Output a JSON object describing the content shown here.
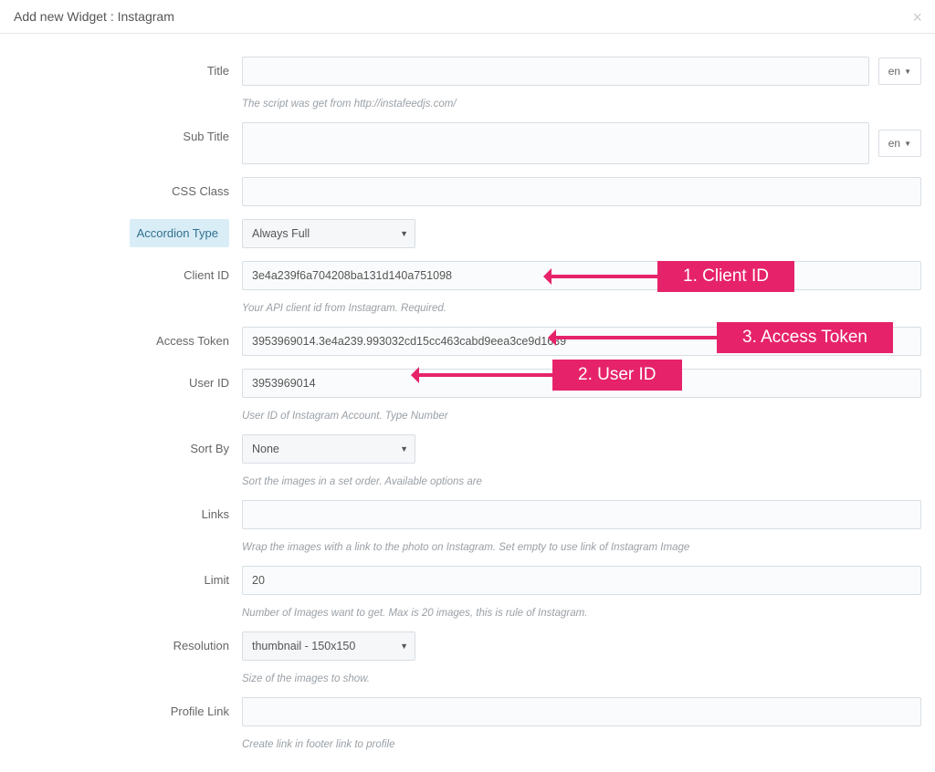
{
  "header": {
    "title": "Add new Widget : Instagram"
  },
  "lang": {
    "label": "en"
  },
  "fields": {
    "title": {
      "label": "Title",
      "value": "",
      "help": "The script was get from http://instafeedjs.com/"
    },
    "subtitle": {
      "label": "Sub Title",
      "value": ""
    },
    "cssclass": {
      "label": "CSS Class",
      "value": ""
    },
    "accordion": {
      "label": "Accordion Type",
      "value": "Always Full"
    },
    "clientid": {
      "label": "Client ID",
      "value": "3e4a239f6a704208ba131d140a751098",
      "help": "Your API client id from Instagram. Required."
    },
    "accesstoken": {
      "label": "Access Token",
      "value": "3953969014.3e4a239.993032cd15cc463cabd9eea3ce9d1639"
    },
    "userid": {
      "label": "User ID",
      "value": "3953969014",
      "help": "User ID of Instagram Account. Type Number"
    },
    "sortby": {
      "label": "Sort By",
      "value": "None",
      "help": "Sort the images in a set order. Available options are"
    },
    "links": {
      "label": "Links",
      "value": "",
      "help": "Wrap the images with a link to the photo on Instagram. Set empty to use link of Instagram Image"
    },
    "limit": {
      "label": "Limit",
      "value": "20",
      "help": "Number of Images want to get. Max is 20 images, this is rule of Instagram."
    },
    "resolution": {
      "label": "Resolution",
      "value": "thumbnail - 150x150",
      "help": "Size of the images to show."
    },
    "profilelink": {
      "label": "Profile Link",
      "value": "",
      "help": "Create link in footer link to profile"
    }
  },
  "callouts": {
    "clientid": "1. Client ID",
    "userid": "2. User ID",
    "accesstoken": "3. Access Token"
  }
}
